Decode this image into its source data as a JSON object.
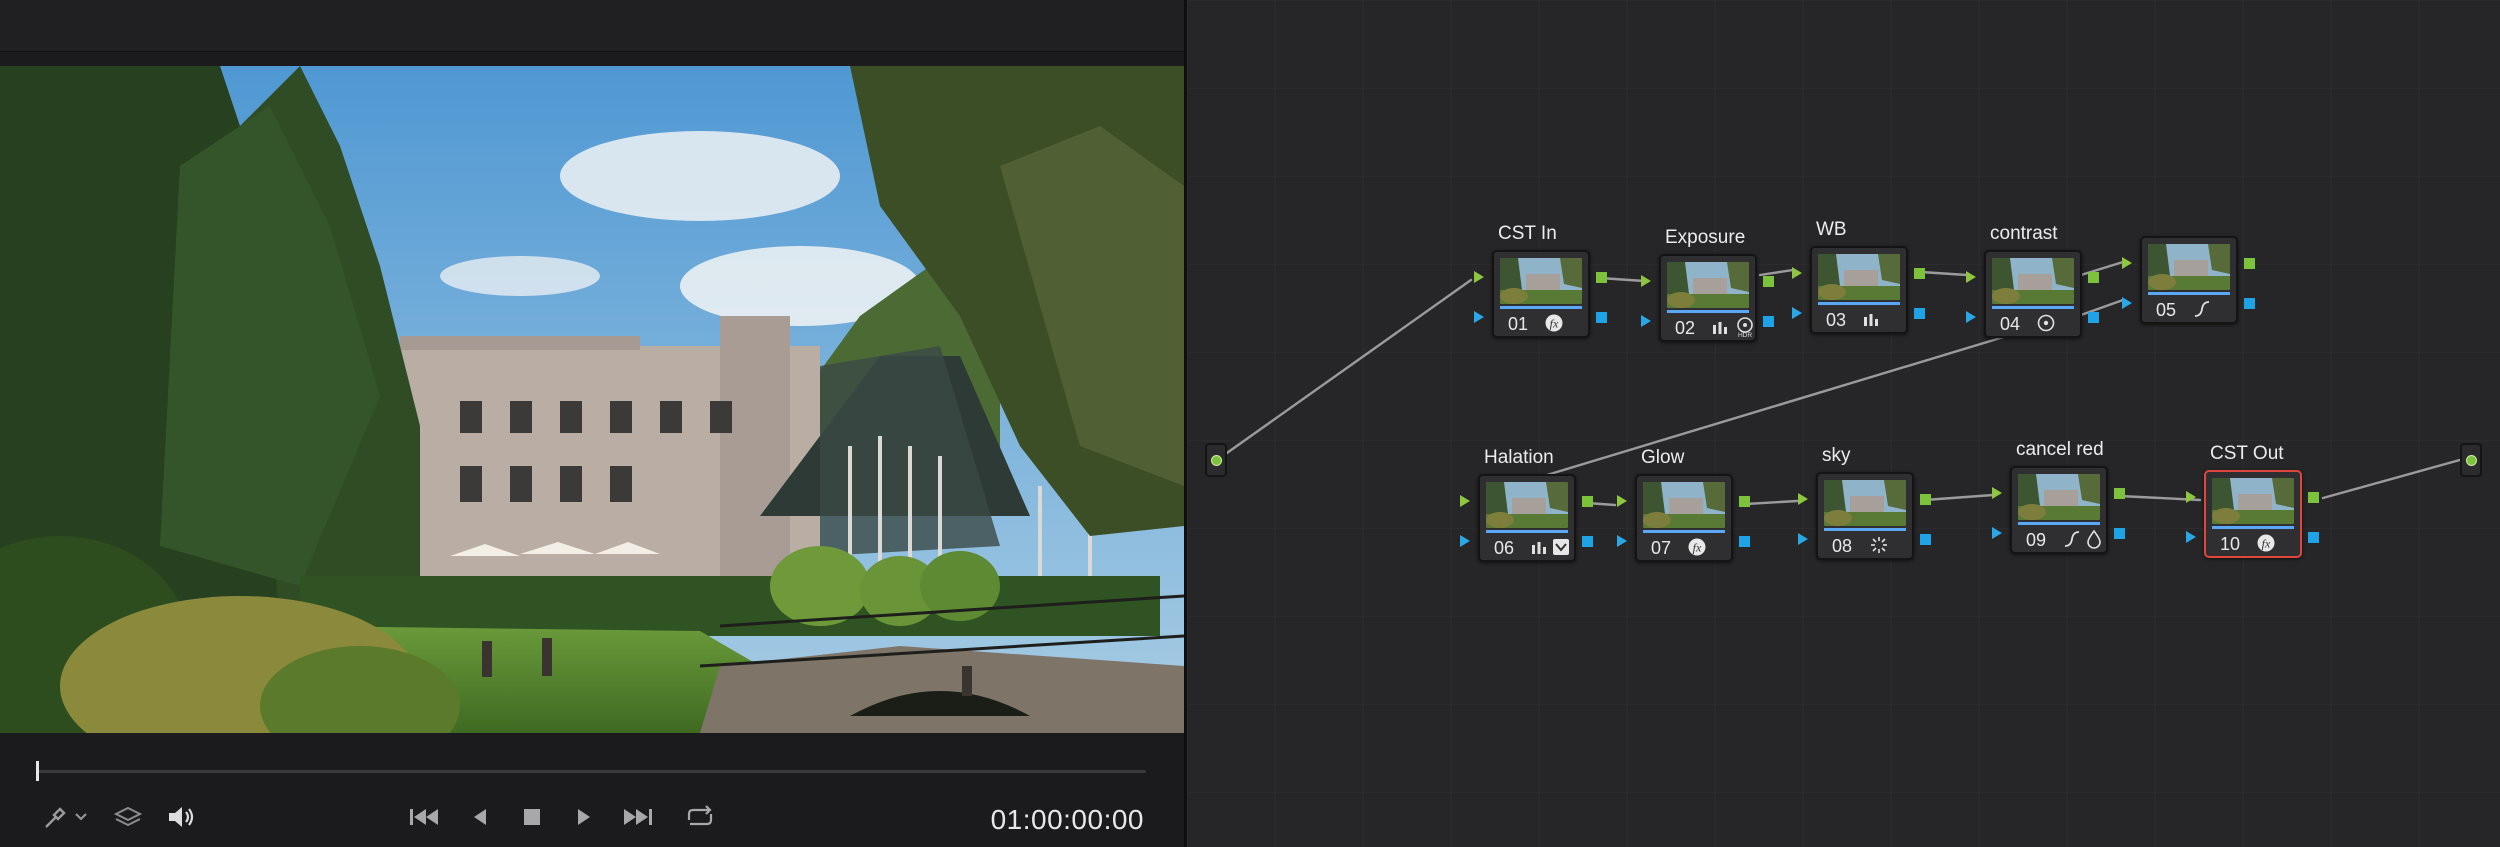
{
  "viewer": {
    "timecode": "01:00:00:00",
    "playhead_fraction": 0.0
  },
  "transport": {
    "icons": [
      "picker-icon",
      "chevron-down-icon",
      "layers-icon",
      "speaker-icon",
      "skip-to-start-icon",
      "step-back-icon",
      "stop-icon",
      "play-icon",
      "skip-to-end-icon",
      "loop-icon"
    ]
  },
  "nodes": [
    {
      "num": "01",
      "label": "CST In",
      "icons": [
        "fx-icon"
      ]
    },
    {
      "num": "02",
      "label": "Exposure",
      "icons": [
        "levels-icon",
        "hdr-icon"
      ]
    },
    {
      "num": "03",
      "label": "WB",
      "icons": [
        "levels-icon"
      ]
    },
    {
      "num": "04",
      "label": "contrast",
      "icons": [
        "target-icon"
      ]
    },
    {
      "num": "05",
      "label": "",
      "icons": [
        "curve-icon"
      ]
    },
    {
      "num": "06",
      "label": "Halation",
      "icons": [
        "levels-icon",
        "checkbox-icon"
      ]
    },
    {
      "num": "07",
      "label": "Glow",
      "icons": [
        "fx-icon"
      ]
    },
    {
      "num": "08",
      "label": "sky",
      "icons": [
        "sparkle-icon"
      ]
    },
    {
      "num": "09",
      "label": "cancel red",
      "icons": [
        "curve-icon",
        "drop-icon"
      ]
    },
    {
      "num": "10",
      "label": "CST Out",
      "icons": [
        "fx-icon"
      ],
      "selected": true
    }
  ],
  "colors": {
    "rgb_port": "#7cc23b",
    "alpha_port": "#1ea4e6",
    "selected_outline": "#e0463b",
    "thumb_bar": "#5aa8f5"
  }
}
